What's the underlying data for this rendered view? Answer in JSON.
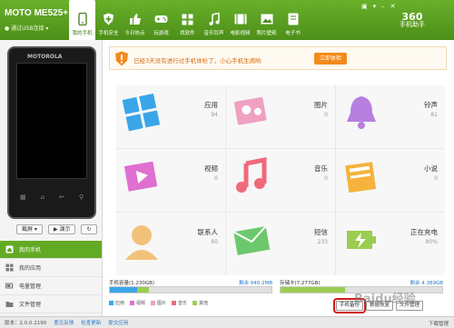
{
  "header": {
    "device_name": "MOTO ME525+",
    "connection": "通过USB连接",
    "tabs": [
      {
        "label": "我的手机",
        "icon": "phone-icon"
      },
      {
        "label": "手机安全",
        "icon": "shield-plus-icon"
      },
      {
        "label": "今日热点",
        "icon": "thumbs-up-icon"
      },
      {
        "label": "玩游戏",
        "icon": "gamepad-icon"
      },
      {
        "label": "找软件",
        "icon": "grid-icon"
      },
      {
        "label": "音乐铃声",
        "icon": "music-note-icon"
      },
      {
        "label": "电影视频",
        "icon": "film-icon"
      },
      {
        "label": "照片壁纸",
        "icon": "picture-icon"
      },
      {
        "label": "电子书",
        "icon": "book-icon"
      }
    ],
    "logo_big": "360",
    "logo_small": "手机助手",
    "accent": "#5aa020"
  },
  "alert": {
    "text": "已经3天没有进行过手机体检了，小心手机生病哟",
    "button": "立即体检"
  },
  "phone": {
    "brand": "MOTOROLA",
    "screenshot_btn": "截屏",
    "demo_btn": "演示"
  },
  "nav": [
    {
      "label": "我的手机",
      "icon": "home-icon",
      "active": true
    },
    {
      "label": "我的应用",
      "icon": "apps-icon"
    },
    {
      "label": "电量管理",
      "icon": "battery-icon"
    },
    {
      "label": "文件管理",
      "icon": "folder-icon"
    }
  ],
  "tiles": [
    {
      "label": "应用",
      "count": "94",
      "color": "#3aa6e8"
    },
    {
      "label": "图片",
      "count": "0",
      "color": "#f0a0c0"
    },
    {
      "label": "铃声",
      "count": "81",
      "color": "#b67fe0"
    },
    {
      "label": "视频",
      "count": "0",
      "color": "#e070d0"
    },
    {
      "label": "音乐",
      "count": "0",
      "color": "#ef6a7a"
    },
    {
      "label": "小说",
      "count": "0",
      "color": "#f5b23c"
    },
    {
      "label": "联系人",
      "count": "60",
      "color": "#f3c27a"
    },
    {
      "label": "短信",
      "count": "233",
      "color": "#6cc86c"
    },
    {
      "label": "正在充电",
      "count": "80%",
      "color": "#9acd50"
    }
  ],
  "storage": {
    "phone_label": "手机容量(1.230GB)",
    "phone_free": "剩余 940.2MB",
    "phone_used_pct": 24,
    "sd_label": "存储卡(7.277GB)",
    "sd_free": "剩余 4.389GB",
    "sd_used_pct": 40,
    "legend": [
      {
        "label": "应用",
        "color": "#3aa6e8"
      },
      {
        "label": "视频",
        "color": "#e070d0"
      },
      {
        "label": "图片",
        "color": "#f0a0c0"
      },
      {
        "label": "音乐",
        "color": "#ef6a7a"
      },
      {
        "label": "其他",
        "color": "#9acd50"
      }
    ]
  },
  "actions": {
    "backup": "手机备份",
    "restore": "数据恢复",
    "files": "文件管理"
  },
  "status": {
    "version": "版本：2.0.0.2190",
    "feedback": "意见反馈",
    "check_update": "检查更新",
    "suggest": "提交应用",
    "download": "下载管理"
  },
  "watermark": "Baidu经验"
}
